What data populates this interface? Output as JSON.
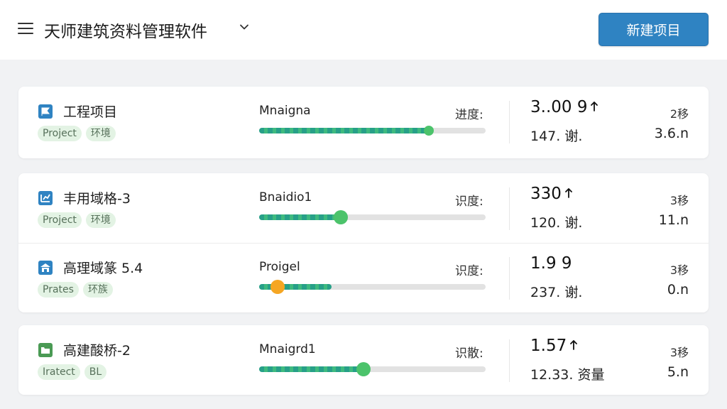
{
  "header": {
    "title": "天师建筑资料管理软件",
    "new_button": "新建项目"
  },
  "projects": [
    {
      "name": "工程项目",
      "icon": "flag-icon",
      "icon_color": "#2f83c2",
      "tags": [
        "Project",
        "环境"
      ],
      "status": "Mnaigna",
      "progress_label": "进度:",
      "progress": 0.75,
      "knob_color": "#4cc36b",
      "metric": "3..00 9",
      "trend": "up",
      "sub_metric": "147. 谢.",
      "rank": "2移",
      "size": "3.6.n"
    },
    {
      "name": "丰用域格-3",
      "icon": "chart-icon",
      "icon_color": "#2f83c2",
      "tags": [
        "Project",
        "环境"
      ],
      "status": "Bnaidio1",
      "progress_label": "识度:",
      "progress": 0.36,
      "knob_color": "#4cc36b",
      "metric": "330",
      "trend": "up",
      "sub_metric": "120. 谢.",
      "rank": "3移",
      "size": "11.n"
    },
    {
      "name": "高理域篆 5.4",
      "icon": "building-icon",
      "icon_color": "#2f83c2",
      "tags": [
        "Prates",
        "环族"
      ],
      "status": "Proigel",
      "progress_label": "识度:",
      "progress": 0.08,
      "knob_color": "#f5a623",
      "metric": "1.9 9",
      "trend": "",
      "sub_metric": "237. 谢.",
      "rank": "3移",
      "size": "0.n"
    },
    {
      "name": "高建酸桥-2",
      "icon": "folder-icon",
      "icon_color": "#4a9a54",
      "tags": [
        "Iratect",
        "BL"
      ],
      "status": "Mnaigrd1",
      "progress_label": "识散:",
      "progress": 0.46,
      "knob_color": "#4cc36b",
      "metric": "1.57",
      "trend": "up",
      "sub_metric": "12.33. 资量",
      "rank": "3移",
      "size": "5.n"
    }
  ]
}
